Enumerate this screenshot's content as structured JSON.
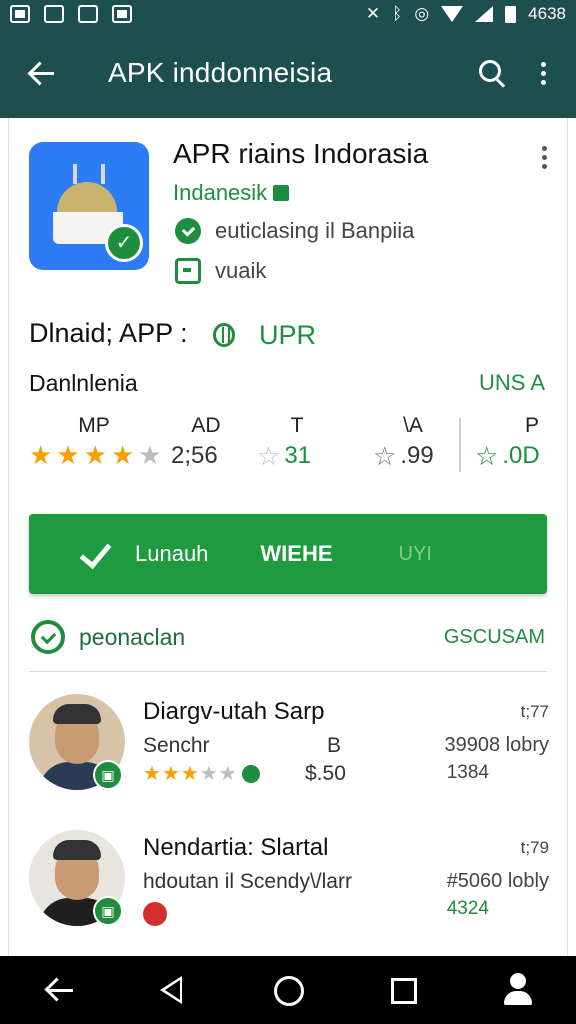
{
  "status_bar": {
    "time": "4638"
  },
  "app_bar": {
    "title": "APK inddonneisia"
  },
  "app": {
    "name": "APR riains Indorasia",
    "developer": "Indanesik",
    "line1": "euticlasing il Banpiia",
    "line2": "vuaik"
  },
  "section": {
    "title": "Dlnaid; APP :",
    "title_right": "UPR",
    "sub_left": "Danlnlenia",
    "sub_right": "UNS A"
  },
  "stats": [
    {
      "head": "MP",
      "value": "",
      "stars_filled": 4,
      "stars_total": 5
    },
    {
      "head": "AD",
      "value": "2;56"
    },
    {
      "head": "T",
      "value": "31"
    },
    {
      "head": "\\A",
      "value": ".99"
    },
    {
      "head": "P",
      "value": ".0D"
    }
  ],
  "install_button": {
    "label1": "Lunauh",
    "label2": "WIEHE",
    "label3": "UYI"
  },
  "reviews_header": {
    "title": "peonaclan",
    "action": "GSCUSAM"
  },
  "reviews": [
    {
      "name": "Diargv-utah Sarp",
      "date": "t;77",
      "line1": "Senchr",
      "mid": "B",
      "right1": "39908 lobry",
      "stars_filled": 3,
      "value": "$.50",
      "right2": "1384"
    },
    {
      "name": "Nendartia: Slartal",
      "date": "t;79",
      "line1": "hdoutan il Scendy\\/larr",
      "right1": "#5060 lobly",
      "right2": "4324"
    }
  ],
  "colors": {
    "appbar": "#1e4f4f",
    "accent": "#1e8e3e",
    "button": "#1e9b3f",
    "star": "#f4a100"
  }
}
